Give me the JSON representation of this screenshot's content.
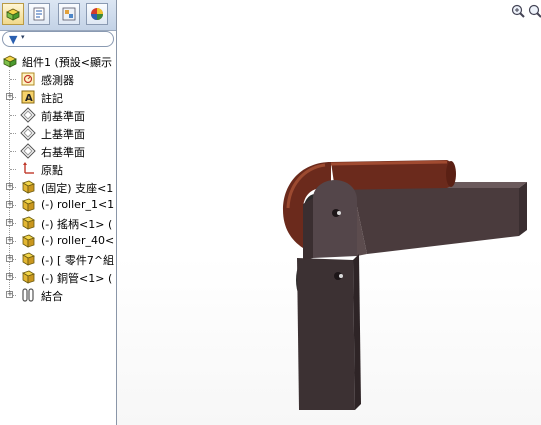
{
  "sidebar": {
    "tabs": [
      {
        "name": "feature-manager-tab",
        "icon": "feature-tree-icon"
      },
      {
        "name": "property-manager-tab",
        "icon": "property-icon"
      },
      {
        "name": "configuration-manager-tab",
        "icon": "configuration-icon"
      },
      {
        "name": "display-manager-tab",
        "icon": "appearance-icon"
      }
    ],
    "filter": {
      "icon": "filter-icon",
      "arrow": "▾"
    },
    "tree": {
      "root_label": "組件1 (預設<顯示",
      "items": [
        {
          "label": "感測器",
          "icon": "sensor-icon",
          "expandable": false
        },
        {
          "label": "註記",
          "icon": "annotation-icon",
          "expandable": true
        },
        {
          "label": "前基準面",
          "icon": "plane-icon",
          "expandable": false
        },
        {
          "label": "上基準面",
          "icon": "plane-icon",
          "expandable": false
        },
        {
          "label": "右基準面",
          "icon": "plane-icon",
          "expandable": false
        },
        {
          "label": "原點",
          "icon": "origin-icon",
          "expandable": false
        },
        {
          "label": "(固定) 支座<1",
          "icon": "part-icon",
          "expandable": true
        },
        {
          "label": "(-) roller_1<1",
          "icon": "part-icon",
          "expandable": true
        },
        {
          "label": "(-) 搖柄<1> (",
          "icon": "part-icon",
          "expandable": true
        },
        {
          "label": "(-) roller_40<",
          "icon": "part-icon",
          "expandable": true
        },
        {
          "label": "(-) [ 零件7^組",
          "icon": "part-icon",
          "expandable": true
        },
        {
          "label": "(-) 銅管<1> (",
          "icon": "part-icon",
          "expandable": true
        },
        {
          "label": "結合",
          "icon": "mates-icon",
          "expandable": true
        }
      ]
    }
  },
  "viewport": {
    "tools": [
      {
        "name": "zoom-to-fit-icon"
      },
      {
        "name": "zoom-to-area-icon"
      }
    ],
    "model": {
      "name": "tube-bender-assembly"
    }
  }
}
